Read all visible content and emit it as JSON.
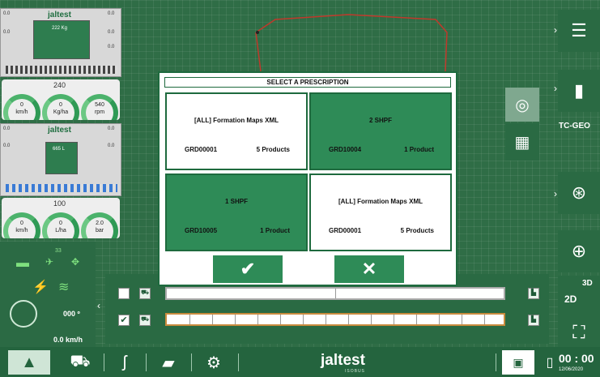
{
  "brand": "jaltest",
  "brand_sub": "ISOBUS",
  "left_panel": {
    "top_machine": {
      "vals": [
        "0.0",
        "0.0",
        "0.0",
        "0.0",
        "0.0"
      ],
      "weight": "222 Kg"
    },
    "gauge1": {
      "top": "240",
      "readouts": [
        "0",
        "0",
        "540"
      ],
      "units": [
        "km/h",
        "Kg/ha",
        "rpm"
      ]
    },
    "bottom_machine": {
      "vals": [
        "0.0",
        "0.0",
        "0.0",
        "0.0"
      ],
      "reading": "665 L"
    },
    "gauge2": {
      "top": "100",
      "readouts": [
        "0",
        "0",
        "2.0"
      ],
      "units": [
        "km/h",
        "L/ha",
        "bar"
      ]
    }
  },
  "status": {
    "satellites": "33",
    "heading": "000 º",
    "speed": "0.0 km/h"
  },
  "right_panel": {
    "tc_label": "TC-GEO",
    "mode_label": "3D",
    "mode_alt": "2D"
  },
  "dialog": {
    "title": "SELECT A PRESCRIPTION",
    "cards": [
      {
        "name": "[ALL] Formation Maps XML",
        "code": "GRD00001",
        "products": "5 Products",
        "style": "white"
      },
      {
        "name": "2 SHPF",
        "code": "GRD10004",
        "products": "1 Product",
        "style": "green"
      },
      {
        "name": "1 SHPF",
        "code": "GRD10005",
        "products": "1 Product",
        "style": "green"
      },
      {
        "name": "[ALL] Formation Maps XML",
        "code": "GRD00001",
        "products": "5 Products",
        "style": "white"
      }
    ],
    "confirm_icon": "✔",
    "cancel_icon": "✕"
  },
  "taskbar": {
    "clock": "00 : 00",
    "date": "12/06/2020"
  },
  "colors": {
    "accent": "#2e8b57",
    "dark": "#1e6a3e",
    "map": "#2f6d46",
    "boundary": "#c0392b"
  }
}
